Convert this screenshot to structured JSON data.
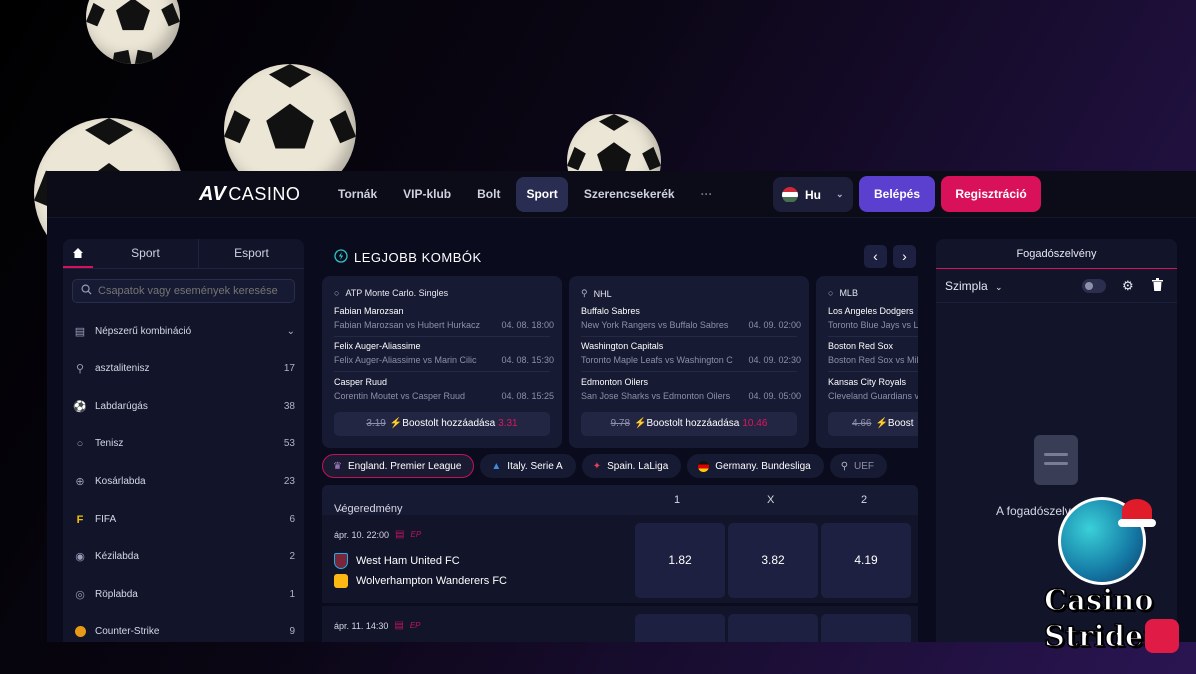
{
  "header": {
    "logo_mark": "AV",
    "logo_text": "CASINO",
    "nav": [
      "Tornák",
      "VIP-klub",
      "Bolt",
      "Sport",
      "Szerencsekerék",
      "···"
    ],
    "active_nav": "Sport",
    "language": "Hu",
    "login_label": "Belépés",
    "register_label": "Regisztráció"
  },
  "sidebar": {
    "tabs": [
      "Sport",
      "Esport"
    ],
    "search_placeholder": "Csapatok vagy események keresése",
    "items": [
      {
        "label": "Népszerű kombináció",
        "count": "",
        "icon": "combo-icon"
      },
      {
        "label": "asztalitenisz",
        "count": "17",
        "icon": "table-tennis-icon"
      },
      {
        "label": "Labdarúgás",
        "count": "38",
        "icon": "football-icon"
      },
      {
        "label": "Tenisz",
        "count": "53",
        "icon": "tennis-icon"
      },
      {
        "label": "Kosárlabda",
        "count": "23",
        "icon": "basketball-icon"
      },
      {
        "label": "FIFA",
        "count": "6",
        "icon": "fifa-icon"
      },
      {
        "label": "Kézilabda",
        "count": "2",
        "icon": "handball-icon"
      },
      {
        "label": "Röplabda",
        "count": "1",
        "icon": "volleyball-icon"
      },
      {
        "label": "Counter-Strike",
        "count": "9",
        "icon": "counter-strike-icon"
      }
    ]
  },
  "combos": {
    "title": "LEGJOBB KOMBÓK",
    "cards": [
      {
        "league": "ATP Monte Carlo. Singles",
        "matches": [
          {
            "pick": "Fabian Marozsan",
            "teams": "Fabian Marozsan vs Hubert Hurkacz",
            "time": "04. 08. 18:00"
          },
          {
            "pick": "Felix Auger-Aliassime",
            "teams": "Felix Auger-Aliassime vs Marin Cilic",
            "time": "04. 08. 15:30"
          },
          {
            "pick": "Casper Ruud",
            "teams": "Corentin Moutet vs Casper Ruud",
            "time": "04. 08. 15:25"
          }
        ],
        "old_odds": "3.19",
        "boost_label": "Boostolt hozzáadása",
        "new_odds": "3.31"
      },
      {
        "league": "NHL",
        "matches": [
          {
            "pick": "Buffalo Sabres",
            "teams": "New York Rangers vs Buffalo Sabres",
            "time": "04. 09. 02:00"
          },
          {
            "pick": "Washington Capitals",
            "teams": "Toronto Maple Leafs vs Washington C",
            "time": "04. 09. 02:30"
          },
          {
            "pick": "Edmonton Oilers",
            "teams": "San Jose Sharks vs Edmonton Oilers",
            "time": "04. 09. 05:00"
          }
        ],
        "old_odds": "9.78",
        "boost_label": "Boostolt hozzáadása",
        "new_odds": "10.46"
      },
      {
        "league": "MLB",
        "matches": [
          {
            "pick": "Los Angeles Dodgers",
            "teams": "Toronto Blue Jays vs Los A",
            "time": ""
          },
          {
            "pick": "Boston Red Sox",
            "teams": "Boston Red Sox vs Mil",
            "time": ""
          },
          {
            "pick": "Kansas City Royals",
            "teams": "Cleveland Guardians vs",
            "time": ""
          }
        ],
        "old_odds": "4.66",
        "boost_label": "Boost",
        "new_odds": ""
      }
    ]
  },
  "leagues": [
    "England. Premier League",
    "Italy. Serie A",
    "Spain. LaLiga",
    "Germany. Bundesliga",
    "UEF"
  ],
  "market": {
    "label": "Végeredmény",
    "cols": [
      "1",
      "X",
      "2"
    ]
  },
  "matches": [
    {
      "date": "ápr. 10. 22:00",
      "tag": "EP",
      "home": "West Ham United FC",
      "away": "Wolverhampton Wanderers FC",
      "odds": [
        "1.82",
        "3.82",
        "4.19"
      ]
    },
    {
      "date": "ápr. 11. 14:30",
      "tag": "EP",
      "home": "",
      "away": "",
      "odds": [
        "",
        "",
        ""
      ]
    }
  ],
  "betslip": {
    "title": "Fogadószelvény",
    "type": "Szimpla",
    "empty_text": "A fogadószelv"
  },
  "watermark": {
    "line1": "Casino",
    "line2": "Strider"
  },
  "colors": {
    "accent_pink": "#d8115a",
    "accent_purple": "#5b3fcf",
    "panel": "#12142a"
  }
}
